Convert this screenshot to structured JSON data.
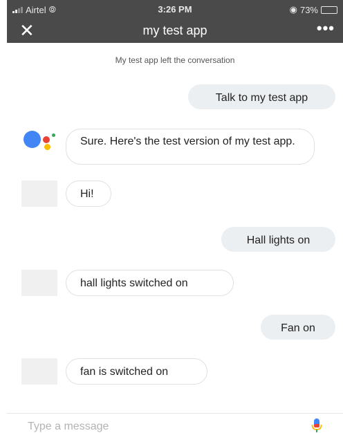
{
  "status_bar": {
    "carrier": "Airtel",
    "time": "3:26 PM",
    "battery_percent": "73%",
    "battery_level": 0.73
  },
  "app_bar": {
    "close_glyph": "✕",
    "title": "my test app",
    "more_glyph": "•••"
  },
  "conversation": {
    "system_notice": "My test app left the conversation",
    "messages": [
      {
        "sender": "user",
        "text": "Talk to my test app"
      },
      {
        "sender": "assistant",
        "text": "Sure. Here's the test version of my test app."
      },
      {
        "sender": "app",
        "text": "Hi!"
      },
      {
        "sender": "user",
        "text": "Hall lights on"
      },
      {
        "sender": "app",
        "text": "hall lights switched on"
      },
      {
        "sender": "user",
        "text": "Fan on"
      },
      {
        "sender": "app",
        "text": "fan is switched on"
      }
    ]
  },
  "composer": {
    "placeholder": "Type a message",
    "value": ""
  },
  "colors": {
    "app_bar": "#4a4a4a",
    "user_bubble": "#eceff1",
    "google_blue": "#4285F4",
    "google_red": "#EA4335",
    "google_yellow": "#FBBC05",
    "google_green": "#34A853"
  }
}
